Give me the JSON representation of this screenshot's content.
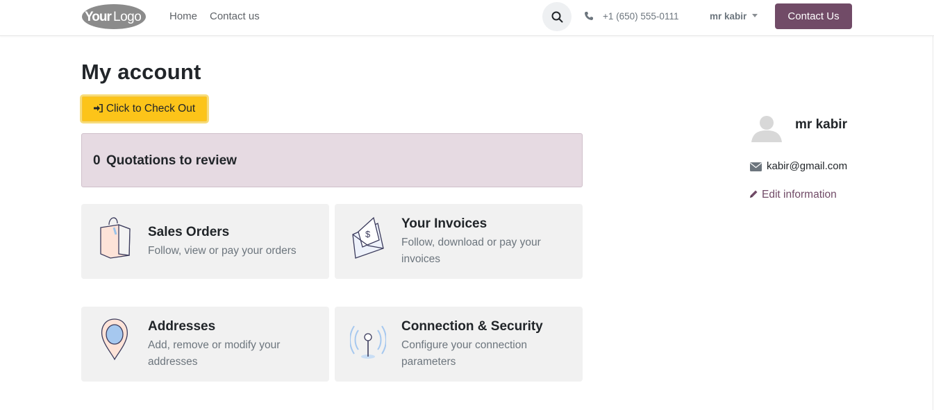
{
  "header": {
    "logo_text": "YourLogo",
    "nav": [
      {
        "label": "Home"
      },
      {
        "label": "Contact us"
      }
    ],
    "phone": "+1 (650) 555-0111",
    "user_name": "mr kabir",
    "contact_button": "Contact Us",
    "icons": {
      "search": "search-icon",
      "phone": "phone-icon",
      "caret": "chevron-down-icon"
    }
  },
  "main": {
    "title": "My account",
    "checkout_button": "Click to Check Out",
    "quotations": {
      "count": "0",
      "label": "Quotations to review"
    },
    "cards": [
      {
        "title": "Sales Orders",
        "description": "Follow, view or pay your orders",
        "icon": "shopping-bag-icon"
      },
      {
        "title": "Your Invoices",
        "description": "Follow, download or pay your invoices",
        "icon": "invoice-envelope-icon"
      },
      {
        "title": "Addresses",
        "description": "Add, remove or modify your addresses",
        "icon": "map-pin-icon"
      },
      {
        "title": "Connection & Security",
        "description": "Configure your connection parameters",
        "icon": "signal-antenna-icon"
      }
    ]
  },
  "sidebar": {
    "name": "mr kabir",
    "email": "kabir@gmail.com",
    "edit_label": "Edit information"
  },
  "colors": {
    "brand": "#714b67",
    "checkout": "#fcc419",
    "quotation_bg": "#e6dae2",
    "card_bg": "#f1f1f1"
  }
}
